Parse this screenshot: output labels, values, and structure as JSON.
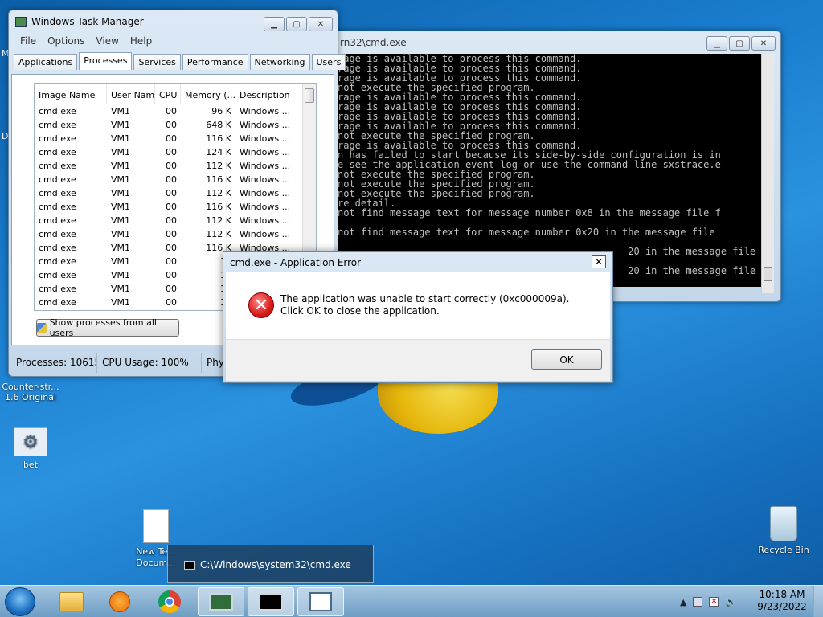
{
  "desktop": {
    "icons": [
      {
        "label": "Counter-str... 1.6 Original"
      },
      {
        "label": "bet"
      },
      {
        "label": "New Te... Docum..."
      },
      {
        "label": "Recycle Bin"
      }
    ],
    "edge_labels": [
      "M",
      "D"
    ]
  },
  "task_manager": {
    "title": "Windows Task Manager",
    "menu": [
      "File",
      "Options",
      "View",
      "Help"
    ],
    "tabs": [
      "Applications",
      "Processes",
      "Services",
      "Performance",
      "Networking",
      "Users"
    ],
    "active_tab": "Processes",
    "columns": [
      "Image Name",
      "User Name",
      "CPU",
      "Memory (...",
      "Description"
    ],
    "rows": [
      [
        "cmd.exe",
        "VM1",
        "00",
        "96 K",
        "Windows ..."
      ],
      [
        "cmd.exe",
        "VM1",
        "00",
        "648 K",
        "Windows ..."
      ],
      [
        "cmd.exe",
        "VM1",
        "00",
        "116 K",
        "Windows ..."
      ],
      [
        "cmd.exe",
        "VM1",
        "00",
        "124 K",
        "Windows ..."
      ],
      [
        "cmd.exe",
        "VM1",
        "00",
        "112 K",
        "Windows ..."
      ],
      [
        "cmd.exe",
        "VM1",
        "00",
        "116 K",
        "Windows ..."
      ],
      [
        "cmd.exe",
        "VM1",
        "00",
        "112 K",
        "Windows ..."
      ],
      [
        "cmd.exe",
        "VM1",
        "00",
        "116 K",
        "Windows ..."
      ],
      [
        "cmd.exe",
        "VM1",
        "00",
        "112 K",
        "Windows ..."
      ],
      [
        "cmd.exe",
        "VM1",
        "00",
        "112 K",
        "Windows ..."
      ],
      [
        "cmd.exe",
        "VM1",
        "00",
        "116 K",
        "Windows ..."
      ],
      [
        "cmd.exe",
        "VM1",
        "00",
        "12",
        ""
      ],
      [
        "cmd.exe",
        "VM1",
        "00",
        "11",
        ""
      ],
      [
        "cmd.exe",
        "VM1",
        "00",
        "11",
        ""
      ],
      [
        "cmd.exe",
        "VM1",
        "00",
        "11",
        ""
      ]
    ],
    "show_all_label": "Show processes from all users",
    "status": {
      "processes": "Processes: 10615",
      "cpu": "CPU Usage: 100%",
      "phys": "Phy"
    }
  },
  "console": {
    "title": "rn32\\cmd.exe",
    "lines": [
      "rage is available to process this command.",
      "rage is available to process this command.",
      "rage is available to process this command.",
      "not execute the specified program.",
      "rage is available to process this command.",
      "rage is available to process this command.",
      "rage is available to process this command.",
      "rage is available to process this command.",
      "not execute the specified program.",
      "rage is available to process this command.",
      "n has failed to start because its side-by-side configuration is in",
      "e see the application event log or use the command-line sxstrace.e",
      "not execute the specified program.",
      "not execute the specified program.",
      "not execute the specified program.",
      "re detail.",
      "not find message text for message number 0x8 in the message file f",
      "",
      "not find message text for message number 0x20 in the message file",
      "",
      "                                                  20 in the message file",
      "",
      "                                                  20 in the message file"
    ]
  },
  "dialog": {
    "title": "cmd.exe - Application Error",
    "message": "The application was unable to start correctly (0xc000009a). Click OK to close the application.",
    "ok_label": "OK"
  },
  "taskbar": {
    "tooltip": "C:\\Windows\\system32\\cmd.exe",
    "time": "10:18 AM",
    "date": "9/23/2022"
  }
}
